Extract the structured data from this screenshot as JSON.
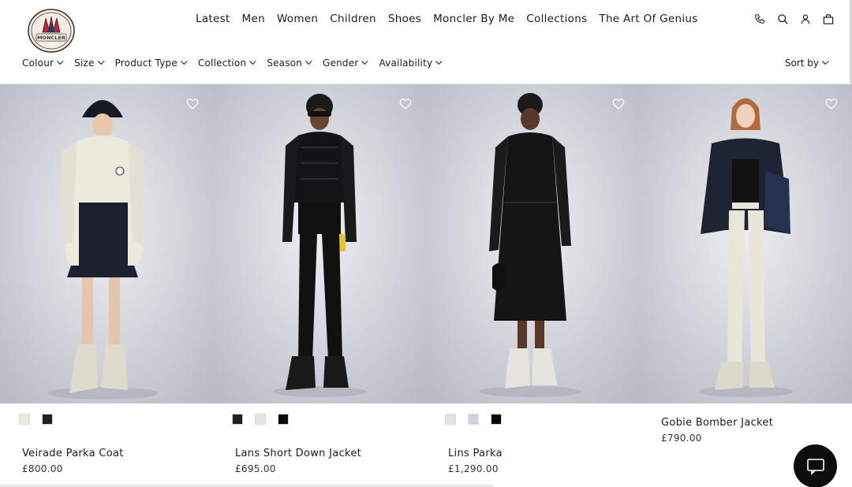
{
  "brand": {
    "logo_text": "MONCLER"
  },
  "nav": [
    "Latest",
    "Men",
    "Women",
    "Children",
    "Shoes",
    "Moncler By Me",
    "Collections",
    "The Art Of Genius"
  ],
  "header_icons": [
    "phone-icon",
    "search-icon",
    "account-icon",
    "bag-icon"
  ],
  "filters": [
    "Colour",
    "Size",
    "Product Type",
    "Collection",
    "Season",
    "Gender",
    "Availability"
  ],
  "sort_label": "Sort by",
  "products": [
    {
      "name": "Veirade Parka Coat",
      "price": "£800.00",
      "swatches": [
        "#ece8dc",
        "#202020"
      ]
    },
    {
      "name": "Lans Short Down Jacket",
      "price": "£695.00",
      "swatches": [
        "#1f1f24",
        "#e7e4dc",
        "#0b0b0b"
      ]
    },
    {
      "name": "Lins Parka",
      "price": "£1,290.00",
      "swatches": [
        "#e6e3dc",
        "#d0d3d9",
        "#080808"
      ]
    },
    {
      "name": "Gobie Bomber Jacket",
      "price": "£790.00",
      "swatches": []
    }
  ],
  "chat_icon": "chat-icon"
}
